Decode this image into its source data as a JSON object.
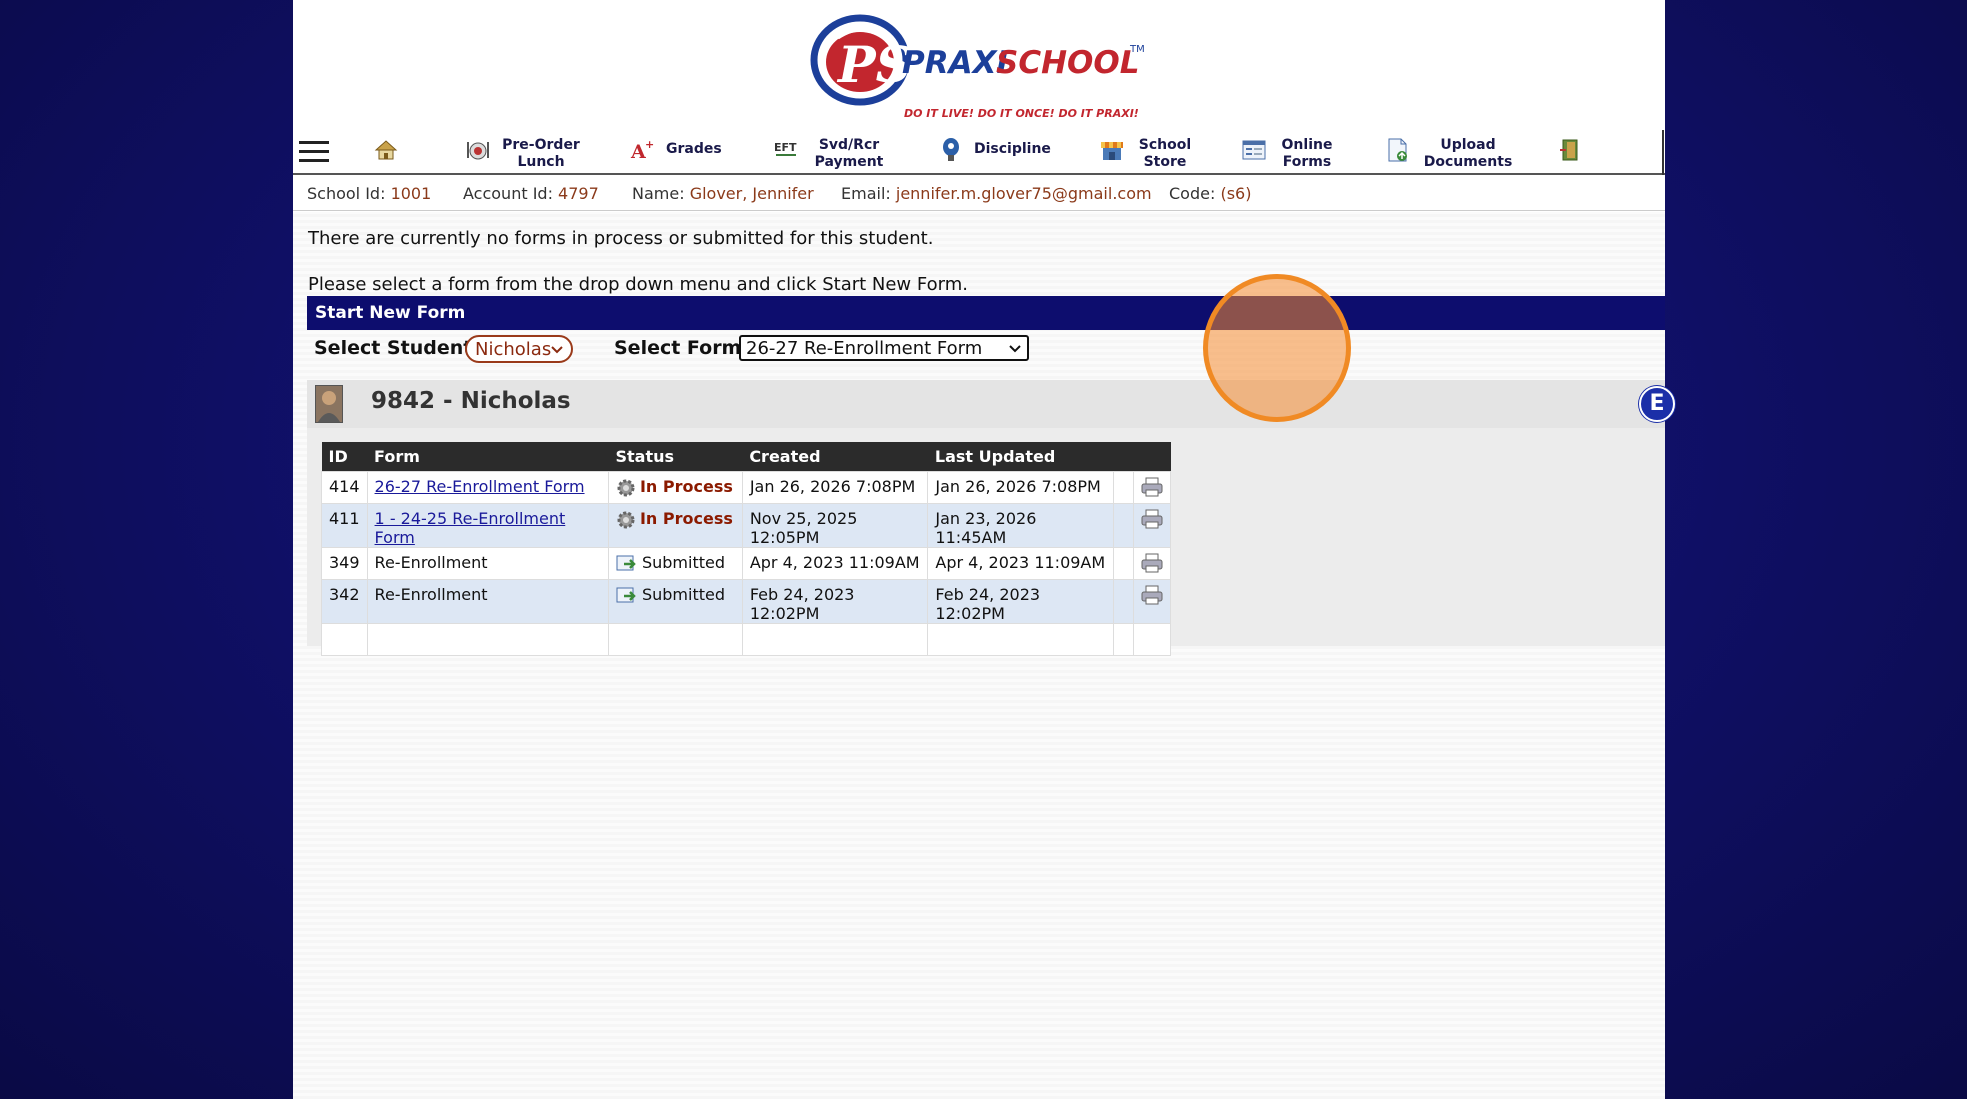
{
  "brand": {
    "name_prefix": "PRAXI",
    "name_suffix": "SCHOOL",
    "trademark": "TM",
    "tagline": "DO IT LIVE!  DO IT ONCE!  DO IT PRAXI!"
  },
  "nav": {
    "menu_icon": "hamburger-icon",
    "items": [
      {
        "label": "",
        "icon": "home-icon"
      },
      {
        "label": "Pre-Order Lunch",
        "icon": "lunch-icon"
      },
      {
        "label": "Grades",
        "icon": "grades-icon"
      },
      {
        "label": "Svd/Rcr Payment",
        "icon": "eft-icon",
        "icon_text": "EFT"
      },
      {
        "label": "Discipline",
        "icon": "discipline-icon"
      },
      {
        "label": "School Store",
        "icon": "store-icon"
      },
      {
        "label": "Online Forms",
        "icon": "forms-icon"
      },
      {
        "label": "Upload Documents",
        "icon": "upload-icon"
      },
      {
        "label": "",
        "icon": "exit-icon"
      }
    ]
  },
  "account": {
    "school_id_label": "School Id:",
    "school_id": "1001",
    "account_id_label": "Account Id:",
    "account_id": "4797",
    "name_label": "Name:",
    "name": "Glover, Jennifer",
    "email_label": "Email:",
    "email": "jennifer.m.glover75@gmail.com",
    "code_label": "Code:",
    "code": "(s6)"
  },
  "messages": {
    "no_forms": "There are currently no forms in process or submitted for this student.",
    "instructions": "Please select a form from the drop down menu and click Start New Form."
  },
  "start_form": {
    "title": "Start New Form",
    "student_label": "Select Student",
    "student_value": "Nicholas",
    "form_label": "Select Form",
    "form_value": "26-27 Re-Enrollment Form"
  },
  "student": {
    "title": "9842 - Nicholas",
    "badge": "E"
  },
  "forms_table": {
    "columns": [
      "ID",
      "Form",
      "Status",
      "Created",
      "Last Updated"
    ],
    "rows": [
      {
        "id": "414",
        "form": "26-27 Re-Enrollment Form",
        "status": "In Process",
        "created": "Jan 26, 2026 7:08PM",
        "updated": "Jan 26, 2026 7:08PM"
      },
      {
        "id": "411",
        "form": "1 - 24-25 Re-Enrollment Form",
        "status": "In Process",
        "created": "Nov 25, 2025 12:05PM",
        "updated": "Jan 23, 2026 11:45AM"
      },
      {
        "id": "349",
        "form": "Re-Enrollment",
        "status": "Submitted",
        "created": "Apr 4, 2023 11:09AM",
        "updated": "Apr 4, 2023 11:09AM"
      },
      {
        "id": "342",
        "form": "Re-Enrollment",
        "status": "Submitted",
        "created": "Feb 24, 2023 12:02PM",
        "updated": "Feb 24, 2023 12:02PM"
      }
    ]
  },
  "colors": {
    "nav_bar": "#0d0d6e",
    "accent_value": "#8b3a1a",
    "highlight": "#f08a24"
  }
}
